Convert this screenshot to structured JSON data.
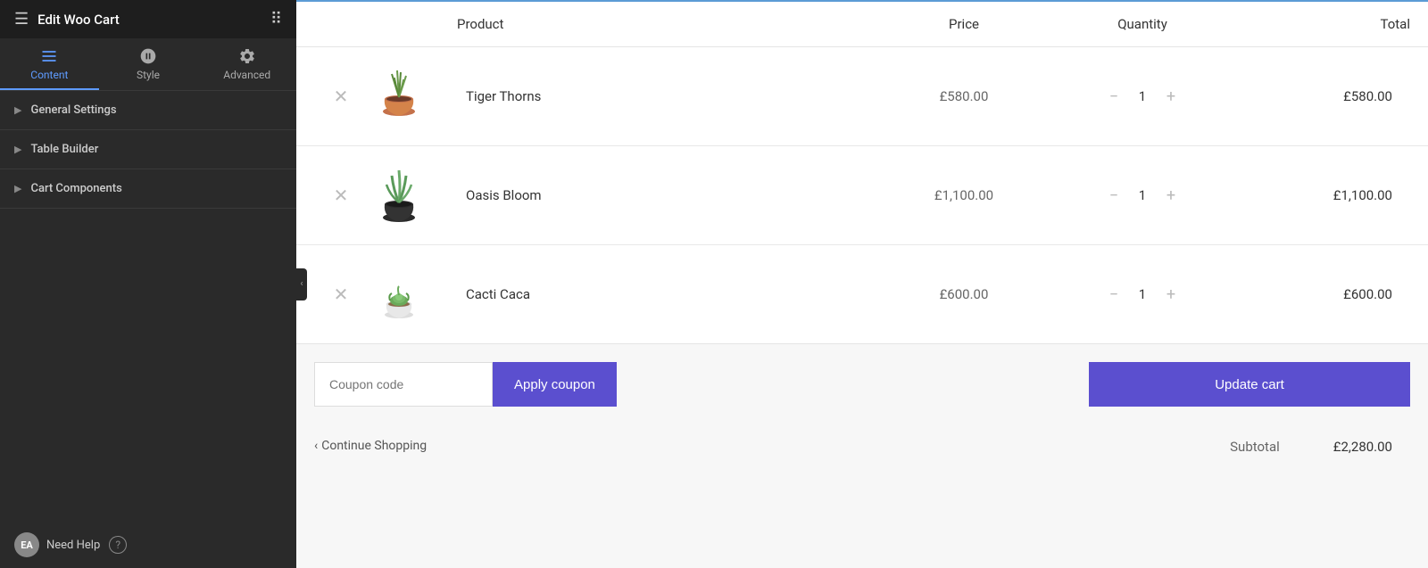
{
  "sidebar": {
    "title": "Edit Woo Cart",
    "tabs": [
      {
        "id": "content",
        "label": "Content",
        "active": true
      },
      {
        "id": "style",
        "label": "Style",
        "active": false
      },
      {
        "id": "advanced",
        "label": "Advanced",
        "active": false
      }
    ],
    "sections": [
      {
        "id": "general-settings",
        "label": "General Settings"
      },
      {
        "id": "table-builder",
        "label": "Table Builder"
      },
      {
        "id": "cart-components",
        "label": "Cart Components"
      }
    ],
    "need_help_label": "Need Help",
    "ea_badge": "EA"
  },
  "cart": {
    "headers": {
      "product": "Product",
      "price": "Price",
      "quantity": "Quantity",
      "total": "Total"
    },
    "rows": [
      {
        "id": 1,
        "name": "Tiger Thorns",
        "price": "£580.00",
        "qty": 1,
        "total": "£580.00"
      },
      {
        "id": 2,
        "name": "Oasis Bloom",
        "price": "£1,100.00",
        "qty": 1,
        "total": "£1,100.00"
      },
      {
        "id": 3,
        "name": "Cacti Caca",
        "price": "£600.00",
        "qty": 1,
        "total": "£600.00"
      }
    ],
    "coupon_placeholder": "Coupon code",
    "apply_coupon_label": "Apply coupon",
    "update_cart_label": "Update cart",
    "continue_shopping_label": "Continue Shopping",
    "subtotal_label": "Subtotal",
    "subtotal_value": "£2,280.00"
  },
  "colors": {
    "accent": "#5b4fcf",
    "active_tab": "#5e9bff"
  }
}
